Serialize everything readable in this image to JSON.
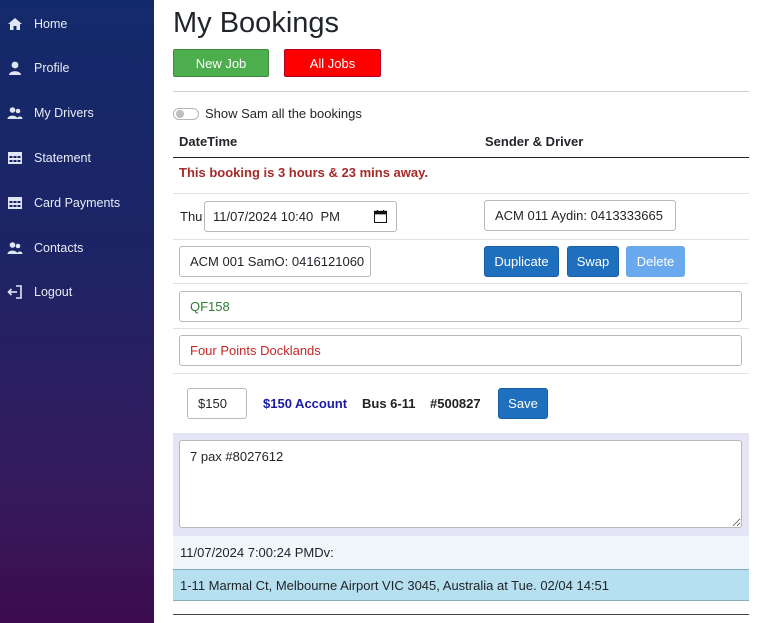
{
  "sidebar": {
    "items": [
      {
        "label": "Home",
        "icon": "home-icon"
      },
      {
        "label": "Profile",
        "icon": "user-icon"
      },
      {
        "label": "My Drivers",
        "icon": "users-icon"
      },
      {
        "label": "Statement",
        "icon": "table-icon"
      },
      {
        "label": "Card Payments",
        "icon": "table-icon"
      },
      {
        "label": "Contacts",
        "icon": "users-icon"
      },
      {
        "label": "Logout",
        "icon": "logout-icon"
      }
    ]
  },
  "header": {
    "title": "My Bookings",
    "new_job_label": "New Job",
    "all_jobs_label": "All Jobs",
    "new_job_color": "#4cae4c",
    "all_jobs_color": "#ff0000"
  },
  "filter": {
    "toggle_label": "Show Sam all the bookings",
    "toggle_on": false
  },
  "table": {
    "columns": [
      "DateTime",
      "Sender & Driver"
    ]
  },
  "booking": {
    "away_message": "This booking is 3 hours & 23 mins away.",
    "day": "Thu",
    "datetime": "11/07/2024 10:40  PM",
    "sender": "ACM 011 Aydin: 0413333665",
    "driver": "ACM 001 SamO: 0416121060",
    "duplicate_label": "Duplicate",
    "swap_label": "Swap",
    "delete_label": "Delete",
    "flight": "QF158",
    "destination": "Four Points Docklands",
    "price_value": "$150",
    "price_account": "$150 Account",
    "bus": "Bus 6-11",
    "job_number": "#500827",
    "save_label": "Save",
    "notes": "7 pax #8027612",
    "log_entry": "11/07/2024 7:00:24 PMDv:",
    "address_entry": "1-11 Marmal Ct, Melbourne Airport VIC 3045, Australia at Tue. 02/04 14:51"
  }
}
